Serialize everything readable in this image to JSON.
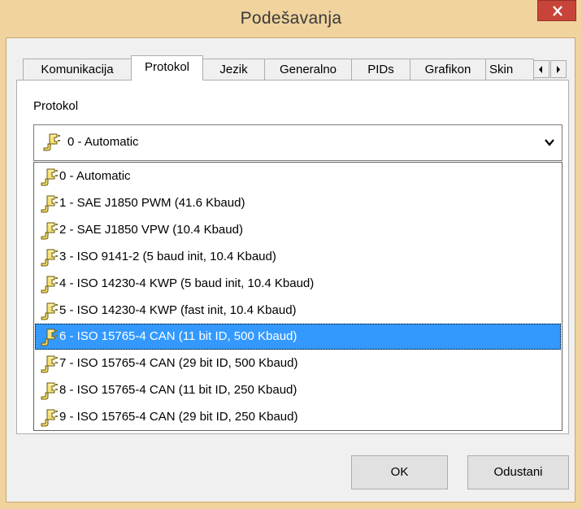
{
  "window": {
    "title": "Podešavanja"
  },
  "tabs": [
    {
      "label": "Komunikacija"
    },
    {
      "label": "Protokol"
    },
    {
      "label": "Jezik"
    },
    {
      "label": "Generalno"
    },
    {
      "label": "PIDs"
    },
    {
      "label": "Grafikon"
    },
    {
      "label": "Skin"
    }
  ],
  "active_tab": "Protokol",
  "protocol": {
    "label": "Protokol",
    "selected_value": "0 - Automatic",
    "options": [
      {
        "label": "0 - Automatic"
      },
      {
        "label": "1 - SAE J1850 PWM (41.6 Kbaud)"
      },
      {
        "label": "2 - SAE J1850 VPW (10.4 Kbaud)"
      },
      {
        "label": "3 - ISO 9141-2 (5 baud init, 10.4 Kbaud)"
      },
      {
        "label": "4 - ISO 14230-4 KWP (5 baud init, 10.4 Kbaud)"
      },
      {
        "label": "5 - ISO 14230-4 KWP (fast init, 10.4 Kbaud)"
      },
      {
        "label": "6 - ISO 15765-4 CAN (11 bit ID, 500 Kbaud)"
      },
      {
        "label": "7 - ISO 15765-4 CAN (29 bit ID, 500 Kbaud)"
      },
      {
        "label": "8 - ISO 15765-4 CAN (11 bit ID, 250 Kbaud)"
      },
      {
        "label": "9 - ISO 15765-4 CAN (29 bit ID, 250 Kbaud)"
      }
    ],
    "highlighted_option": "6 - ISO 15765-4 CAN (11 bit ID, 500 Kbaud)"
  },
  "buttons": {
    "ok": "OK",
    "cancel": "Odustani"
  },
  "colors": {
    "accent": "#3399ff",
    "close": "#c8443a",
    "frame": "#f1d39e"
  },
  "icons": {
    "option_icon": "connector-plug-icon"
  }
}
